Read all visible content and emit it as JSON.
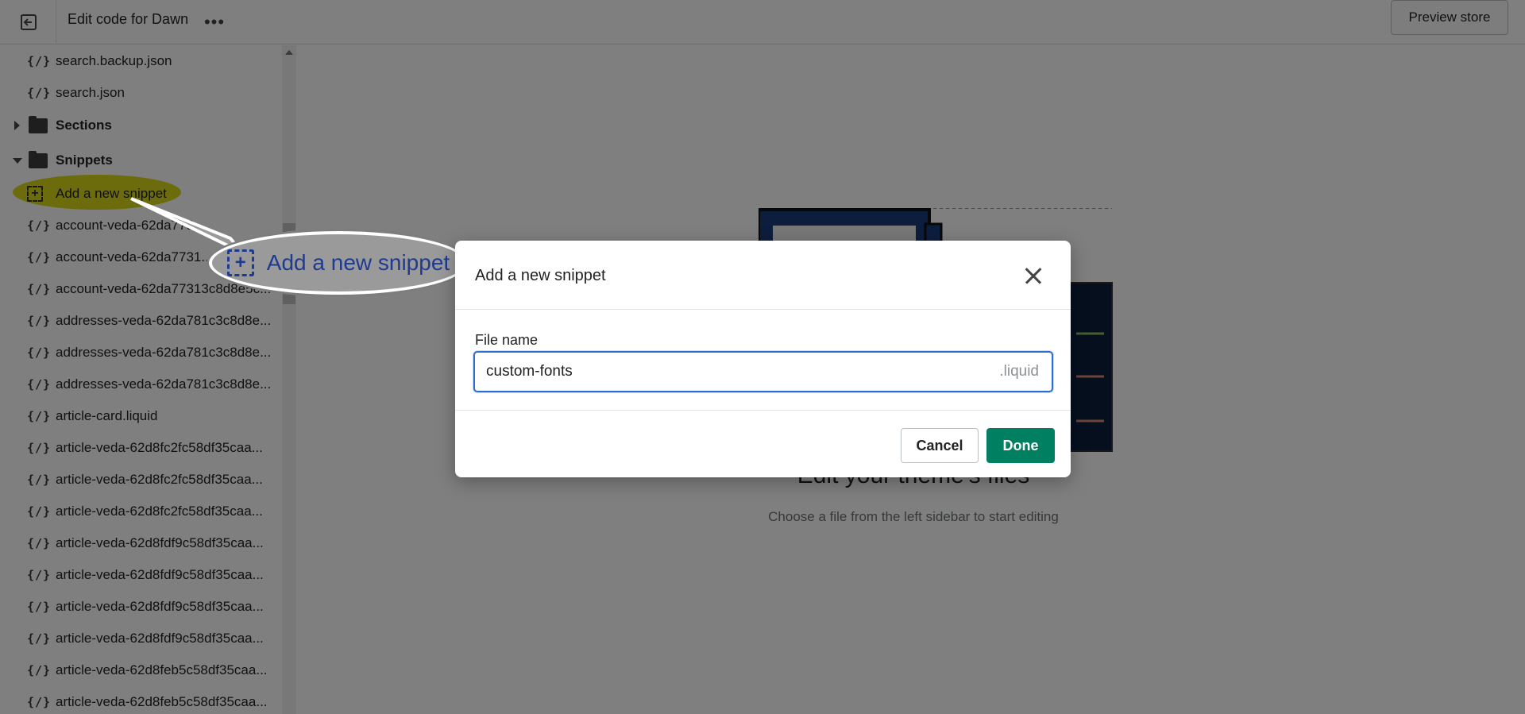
{
  "topbar": {
    "title": "Edit code for Dawn",
    "more_label": "•••",
    "preview_label": "Preview store"
  },
  "sidebar": {
    "items": [
      {
        "icon": "code-file-icon",
        "label": "search.backup.json"
      },
      {
        "icon": "code-file-icon",
        "label": "search.json"
      },
      {
        "icon": "folder-icon",
        "label": "Sections",
        "state": "collapsed"
      },
      {
        "icon": "folder-icon",
        "label": "Snippets",
        "state": "expanded"
      },
      {
        "icon": "add-file-icon",
        "label": "Add a new snippet"
      },
      {
        "icon": "code-file-icon",
        "label": "account-veda-62da773..."
      },
      {
        "icon": "code-file-icon",
        "label": "account-veda-62da7731..."
      },
      {
        "icon": "code-file-icon",
        "label": "account-veda-62da77313c8d8e5c..."
      },
      {
        "icon": "code-file-icon",
        "label": "addresses-veda-62da781c3c8d8e..."
      },
      {
        "icon": "code-file-icon",
        "label": "addresses-veda-62da781c3c8d8e..."
      },
      {
        "icon": "code-file-icon",
        "label": "addresses-veda-62da781c3c8d8e..."
      },
      {
        "icon": "code-file-icon",
        "label": "article-card.liquid"
      },
      {
        "icon": "code-file-icon",
        "label": "article-veda-62d8fc2fc58df35caa..."
      },
      {
        "icon": "code-file-icon",
        "label": "article-veda-62d8fc2fc58df35caa..."
      },
      {
        "icon": "code-file-icon",
        "label": "article-veda-62d8fc2fc58df35caa..."
      },
      {
        "icon": "code-file-icon",
        "label": "article-veda-62d8fdf9c58df35caa..."
      },
      {
        "icon": "code-file-icon",
        "label": "article-veda-62d8fdf9c58df35caa..."
      },
      {
        "icon": "code-file-icon",
        "label": "article-veda-62d8fdf9c58df35caa..."
      },
      {
        "icon": "code-file-icon",
        "label": "article-veda-62d8fdf9c58df35caa..."
      },
      {
        "icon": "code-file-icon",
        "label": "article-veda-62d8feb5c58df35caa..."
      },
      {
        "icon": "code-file-icon",
        "label": "article-veda-62d8feb5c58df35caa..."
      }
    ],
    "code_glyph": "{/}"
  },
  "callout": {
    "text": "Add a new snippet",
    "highlight_color": "#d7d400",
    "text_color": "#1f3a93"
  },
  "main": {
    "empty_title": "Edit your theme's files",
    "empty_subtitle": "Choose a file from the left sidebar to start editing"
  },
  "modal": {
    "title": "Add a new snippet",
    "field_label": "File name",
    "field_value": "custom-fonts",
    "field_suffix": ".liquid",
    "cancel_label": "Cancel",
    "done_label": "Done",
    "primary_color": "#008060"
  }
}
